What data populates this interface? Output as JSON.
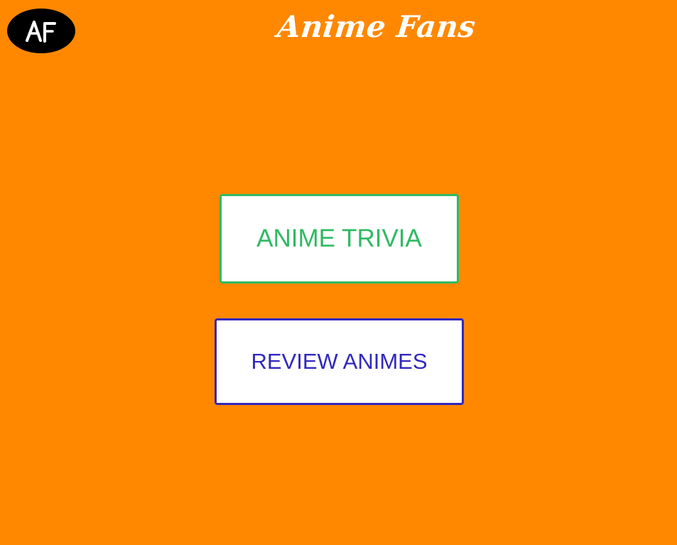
{
  "header": {
    "logo_text": "AF",
    "title": "Anime Fans"
  },
  "menu": {
    "trivia_label": "ANIME TRIVIA",
    "review_label": "REVIEW ANIMES"
  },
  "colors": {
    "background": "#ff8800",
    "trivia_accent": "#2fba63",
    "review_accent": "#3128be"
  },
  "icons": {
    "logo": "af-logo-icon"
  }
}
